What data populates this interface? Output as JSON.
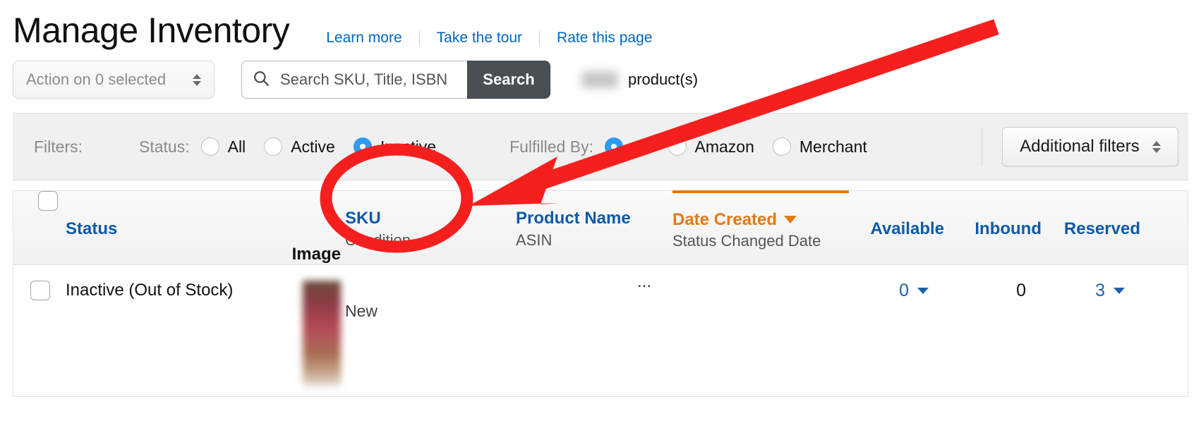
{
  "header": {
    "title": "Manage Inventory",
    "links": [
      {
        "label": "Learn more"
      },
      {
        "label": "Take the tour"
      },
      {
        "label": "Rate this page"
      }
    ]
  },
  "toolbar": {
    "action_select_label": "Action on 0 selected",
    "search_placeholder": "Search SKU, Title, ISBN",
    "search_value": "",
    "search_button_label": "Search",
    "product_count_label": "product(s)",
    "product_count_value": ""
  },
  "filters": {
    "label": "Filters:",
    "status": {
      "label": "Status:",
      "options": [
        {
          "label": "All",
          "selected": false
        },
        {
          "label": "Active",
          "selected": false
        },
        {
          "label": "Inactive",
          "selected": true
        }
      ]
    },
    "fulfilled_by": {
      "label": "Fulfilled By:",
      "options": [
        {
          "label": "All",
          "selected": true
        },
        {
          "label": "Amazon",
          "selected": false
        },
        {
          "label": "Merchant",
          "selected": false
        }
      ]
    },
    "additional_filters_label": "Additional filters"
  },
  "table": {
    "columns": [
      {
        "main": "Status",
        "sub": "",
        "link": true
      },
      {
        "main": "Image",
        "sub": "",
        "link": false
      },
      {
        "main": "SKU",
        "sub": "Condition",
        "link": true
      },
      {
        "main": "Product Name",
        "sub": "ASIN",
        "link": true
      },
      {
        "main": "Date Created",
        "sub": "Status Changed Date",
        "link": true,
        "sorted": true,
        "sort_direction": "desc"
      },
      {
        "main": "Available",
        "sub": "",
        "link": true
      },
      {
        "main": "Inbound",
        "sub": "",
        "link": true
      },
      {
        "main": "Reserved",
        "sub": "",
        "link": true
      }
    ],
    "rows": [
      {
        "status": "Inactive (Out of Stock)",
        "sku": "",
        "condition": "New",
        "product_name": "",
        "product_name_truncation": "...",
        "date_created": "",
        "status_changed_date": "",
        "available": "0",
        "inbound": "0",
        "reserved": "3"
      }
    ]
  },
  "annotations": {
    "highlight_color": "#f5201e",
    "ellipse_target": "Inactive status radio option",
    "arrow_target": "Inactive status radio option"
  }
}
